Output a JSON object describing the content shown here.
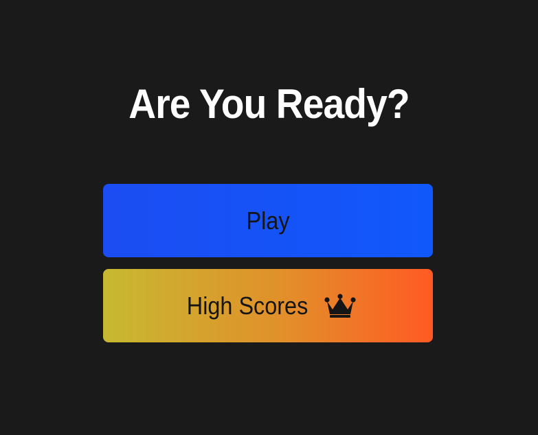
{
  "screen": {
    "title": "Are You Ready?"
  },
  "menu": {
    "play_label": "Play",
    "high_scores_label": "High Scores",
    "high_scores_icon": "crown-icon"
  },
  "colors": {
    "background": "#1a1a1a",
    "play_button": "#1158fb",
    "high_scores_gradient_start": "#c6b931",
    "high_scores_gradient_end": "#ff5a24",
    "button_text": "#151515",
    "title_text": "#ffffff"
  }
}
